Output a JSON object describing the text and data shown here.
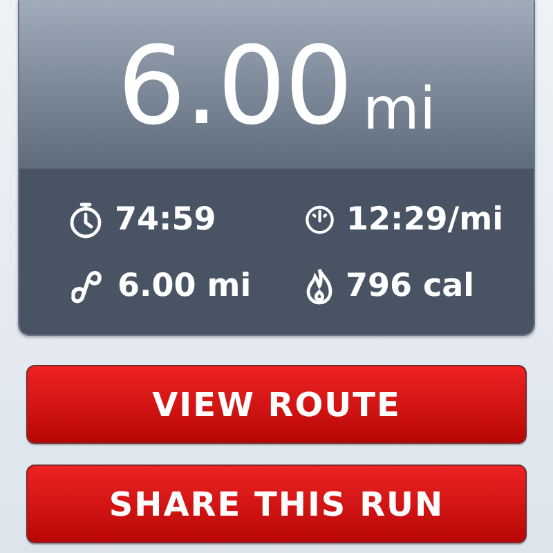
{
  "summary": {
    "distance": "6.00",
    "unit": "mi"
  },
  "stats": [
    {
      "kind": "time",
      "value": "74:59"
    },
    {
      "kind": "pace",
      "value": "12:29/mi"
    },
    {
      "kind": "distance",
      "value": "6.00 mi"
    },
    {
      "kind": "calories",
      "value": "796 cal"
    }
  ],
  "buttons": [
    "VIEW ROUTE",
    "SHARE THIS RUN"
  ]
}
